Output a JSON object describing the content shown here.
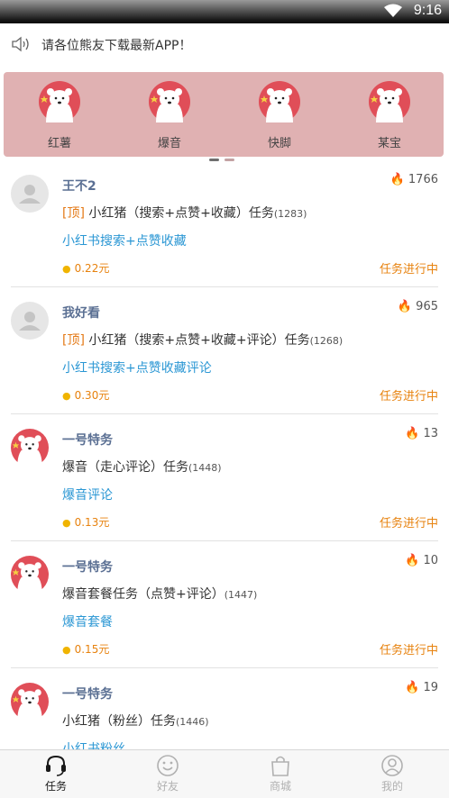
{
  "status_bar": {
    "time": "9:16"
  },
  "notice": {
    "text": "请各位熊友下载最新APP！"
  },
  "banner": {
    "items": [
      {
        "label": "红薯"
      },
      {
        "label": "爆音"
      },
      {
        "label": "快脚"
      },
      {
        "label": "某宝"
      }
    ]
  },
  "tasks": [
    {
      "name": "王不2",
      "heat": "1766",
      "top_tag": "[顶]",
      "title": "小红猪（搜索+点赞+收藏）任务",
      "task_id": "(1283)",
      "subtitle": "小红书搜索+点赞收藏",
      "price": "0.22元",
      "status": "任务进行中",
      "avatar": "default"
    },
    {
      "name": "我好看",
      "heat": "965",
      "top_tag": "[顶]",
      "title": "小红猪（搜索+点赞+收藏+评论）任务",
      "task_id": "(1268)",
      "subtitle": "小红书搜索+点赞收藏评论",
      "price": "0.30元",
      "status": "任务进行中",
      "avatar": "default"
    },
    {
      "name": "一号特务",
      "heat": "13",
      "top_tag": "",
      "title": "爆音（走心评论）任务",
      "task_id": "(1448)",
      "subtitle": "爆音评论",
      "price": "0.13元",
      "status": "任务进行中",
      "avatar": "bear"
    },
    {
      "name": "一号特务",
      "heat": "10",
      "top_tag": "",
      "title": "爆音套餐任务（点赞+评论）",
      "task_id": "(1447)",
      "subtitle": "爆音套餐",
      "price": "0.15元",
      "status": "任务进行中",
      "avatar": "bear"
    },
    {
      "name": "一号特务",
      "heat": "19",
      "top_tag": "",
      "title": "小红猪（粉丝）任务",
      "task_id": "(1446)",
      "subtitle": "小红书粉丝",
      "price": "",
      "status": "",
      "avatar": "bear"
    }
  ],
  "tabbar": {
    "tabs": [
      {
        "label": "任务",
        "icon": "headset-icon",
        "active": true
      },
      {
        "label": "好友",
        "icon": "smiley-icon",
        "active": false
      },
      {
        "label": "商城",
        "icon": "shopping-bag-icon",
        "active": false
      },
      {
        "label": "我的",
        "icon": "user-icon",
        "active": false
      }
    ]
  },
  "colors": {
    "banner_bg": "#e0b1b2",
    "accent_orange": "#e7820e",
    "link_blue": "#2b97d4",
    "active_tab": "#1a1a1a",
    "inactive_tab": "#b0b0b0"
  }
}
